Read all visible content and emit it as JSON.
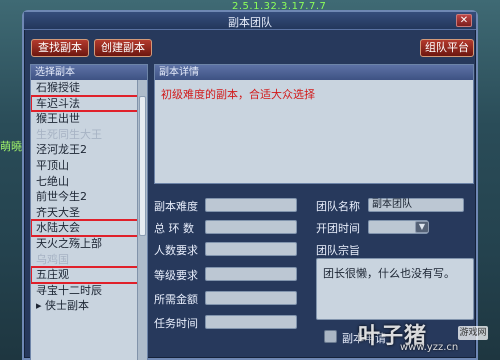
{
  "background": {
    "top_ticker": "2.5.1.32.3.17.7.7",
    "left_fragment": "萌曉"
  },
  "window": {
    "title": "副本团队",
    "close_glyph": "✕"
  },
  "toolbar": {
    "find_label": "查找副本",
    "create_label": "创建副本",
    "platform_label": "组队平台"
  },
  "list": {
    "header": "选择副本",
    "items": [
      {
        "label": "石猴授徒",
        "state": "normal"
      },
      {
        "label": "车迟斗法",
        "state": "highlight"
      },
      {
        "label": "猴王出世",
        "state": "normal"
      },
      {
        "label": "生死同生大王",
        "state": "faded"
      },
      {
        "label": "泾河龙王2",
        "state": "normal"
      },
      {
        "label": "平顶山",
        "state": "normal"
      },
      {
        "label": "七绝山",
        "state": "normal"
      },
      {
        "label": "前世今生2",
        "state": "normal"
      },
      {
        "label": "齐天大圣",
        "state": "normal"
      },
      {
        "label": "水陆大会",
        "state": "highlight"
      },
      {
        "label": "天火之殇上部",
        "state": "normal"
      },
      {
        "label": "乌鸡国",
        "state": "faded"
      },
      {
        "label": "五庄观",
        "state": "highlight"
      },
      {
        "label": "寻宝十二时辰",
        "state": "normal"
      },
      {
        "label": "▸ 侠士副本",
        "state": "normal"
      }
    ]
  },
  "detail": {
    "header": "副本详情",
    "text": "初级难度的副本，合适大众选择"
  },
  "form": {
    "difficulty_label": "副本难度",
    "rounds_label": "总 环 数",
    "people_label": "人数要求",
    "level_label": "等级要求",
    "money_label": "所需金额",
    "time_label": "任务时间",
    "team_name_label": "团队名称",
    "team_name_value": "副本团队",
    "open_time_label": "开团时间",
    "goal_label": "团队宗旨",
    "goal_value": "团长很懒，什么也没有写。",
    "apply_label": "副本申请"
  },
  "watermark": {
    "text": "叶子猪",
    "url": "www.yzz.cn",
    "badge": "游戏网"
  }
}
